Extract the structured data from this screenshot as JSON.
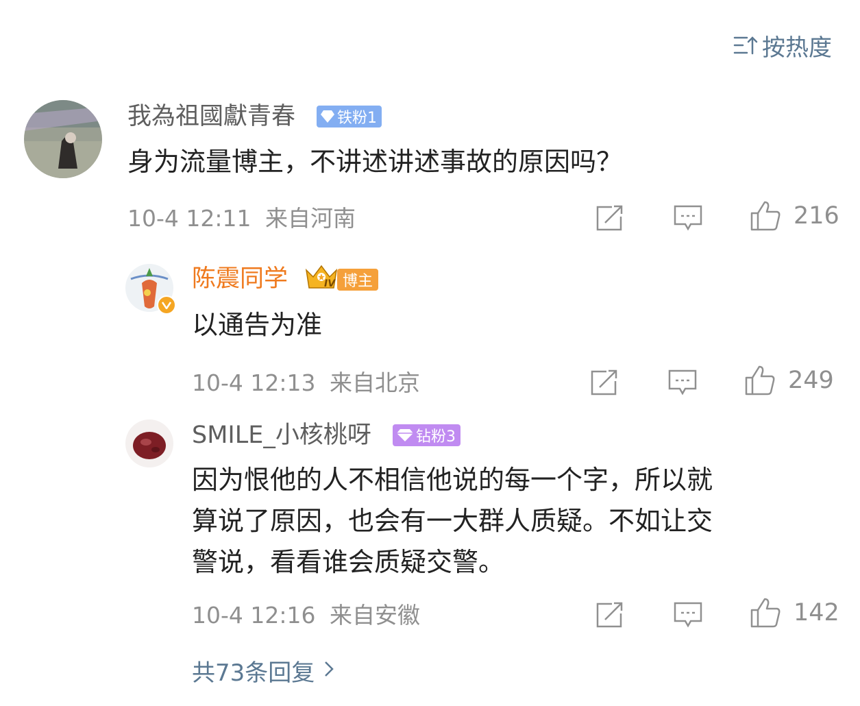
{
  "sort": {
    "label": "按热度",
    "icon": "sort-icon"
  },
  "comments": [
    {
      "name": "我為祖國獻青春",
      "badge": "铁粉1",
      "text": "身为流量博主，不讲述讲述事故的原因吗？",
      "time": "10-4 12:11",
      "location": "来自河南",
      "likes": "216"
    },
    {
      "name": "陈震同学",
      "badge": "博主",
      "crown_text": "IV",
      "text": "以通告为准",
      "time": "10-4 12:13",
      "location": "来自北京",
      "likes": "249"
    },
    {
      "name": "SMILE_小核桃呀",
      "badge": "钻粉3",
      "text_lines": [
        "因为恨他的人不相信他说的每一个字，所以就",
        "算说了原因，也会有一大群人质疑。不如让交",
        "警说，看看谁会质疑交警。"
      ],
      "time": "10-4 12:16",
      "location": "来自安徽",
      "likes": "142"
    }
  ],
  "more_replies": "共73条回复",
  "colors": {
    "link": "#5b7892",
    "meta": "#8f8f8f",
    "author_name": "#ef7a1e",
    "verified": "#f5a623"
  }
}
